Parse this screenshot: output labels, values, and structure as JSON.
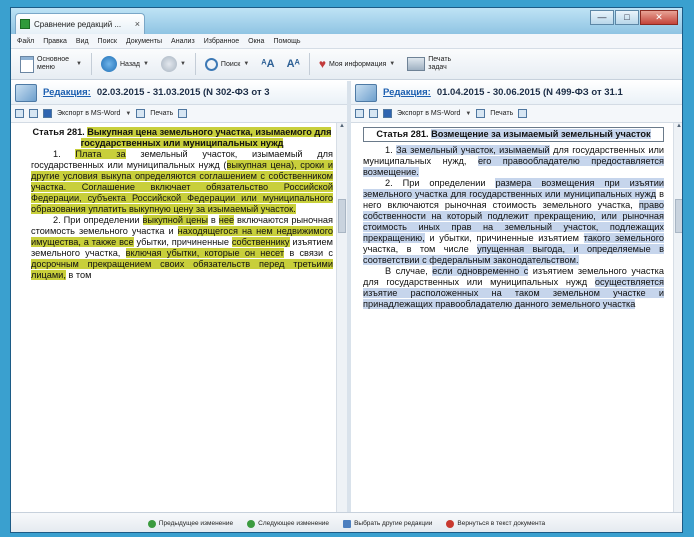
{
  "window": {
    "tab_title": "Сравнение редакций ...",
    "tab_close": "×",
    "minimize": "—",
    "maximize": "□",
    "close": "✕"
  },
  "menu": [
    "Файл",
    "Правка",
    "Вид",
    "Поиск",
    "Документы",
    "Анализ",
    "Избранное",
    "Окна",
    "Помощь"
  ],
  "toolbar": {
    "main_menu": "Основное меню",
    "back": "Назад",
    "search": "Поиск",
    "my_info": "Моя информация",
    "print_tasks": "Печать задач"
  },
  "left": {
    "edition_label": "Редакция:",
    "edition_text": "02.03.2015 - 31.03.2015 (N 302-ФЗ от 3",
    "export": "Экспорт в MS-Word",
    "print": "Печать"
  },
  "right": {
    "edition_label": "Редакция:",
    "edition_text": "01.04.2015 - 30.06.2015 (N 499-ФЗ от 31.1",
    "export": "Экспорт в MS-Word",
    "print": "Печать"
  },
  "left_doc": {
    "title_a": "Статья     281.     ",
    "title_b": "Выкупная     цена земельного      участка, изымаемого      для государственных      или муниципальных нужд",
    "p1_a": "1.  ",
    "p1_b": "Плата  за",
    "p1_c": "  земельный  участок, изымаемый  для  государственных  или муниципальных нужд (",
    "p1_d": "выкупная цена",
    "p1_e": "), сроки и другие условия выкупа определяются соглашением с собственником участка. Соглашение  включает  обязательство Российской      Федерации,      субъекта Российской Федерации или муниципального образования уплатить выкупную цену за изымаемый участок.",
    "p2_a": "2. При определении ",
    "p2_b": "выкупной цены",
    "p2_c": " в ",
    "p2_d": "нее",
    "p2_e": "   включаются   рыночная   стоимость земельного участка и ",
    "p2_f": "находящегося на нем недвижимого  имущества,  а  также  все",
    "p2_g": " убытки,      причиненные      ",
    "p2_h": "собственнику",
    "p2_i": " изъятием  земельного  участка,  ",
    "p2_j": "включая убытки,  которые  он  несет",
    "p2_k": "  в  связи  с ",
    "p2_l": "досрочным      прекращением      своих обязательств перед третьими лицами,",
    "p2_m": " в том"
  },
  "right_doc": {
    "title_a": "Статья 281. ",
    "title_b": "Возмещение за изымаемый земельный участок",
    "p1_a": "1. ",
    "p1_b": "За  земельный  участок,  изымаемый",
    "p1_c": " для  государственных  или  муниципальных нужд, ",
    "p1_d": "его правообладателю предоставляется возмещение.",
    "p2_a": "2.       При       определении       ",
    "p2_b": "размера возмещения при изъятии земельного участка для государственных или муниципальных нужд",
    "p2_c": " в  него  включаются  рыночная  стоимость земельного участка, ",
    "p2_d": "право собственности на который   подлежит   прекращению,   или рыночная стоимость иных прав на земельный участок, подлежащих прекращению,",
    "p2_e": " и убытки, причиненные  изъятием  ",
    "p2_f": "такого  земельного",
    "p2_g": " участка, в том числе ",
    "p2_h": "упущенная выгода, и определяемые    в    соответствии    с федеральным законодательством.",
    "p3_a": "В   случае,   ",
    "p3_b": "если   одновременно   с",
    "p3_c": " изъятием         земельного         участка         для государственных или муниципальных нужд ",
    "p3_d": "осуществляется изъятие расположенных на таком земельном участке и принадлежащих правообладателю данного земельного участка"
  },
  "footer": {
    "prev_change": "Предыдущее изменение",
    "next_change": "Следующее изменение",
    "choose_other": "Выбрать другие редакции",
    "return_text": "Вернуться в текст документа"
  }
}
